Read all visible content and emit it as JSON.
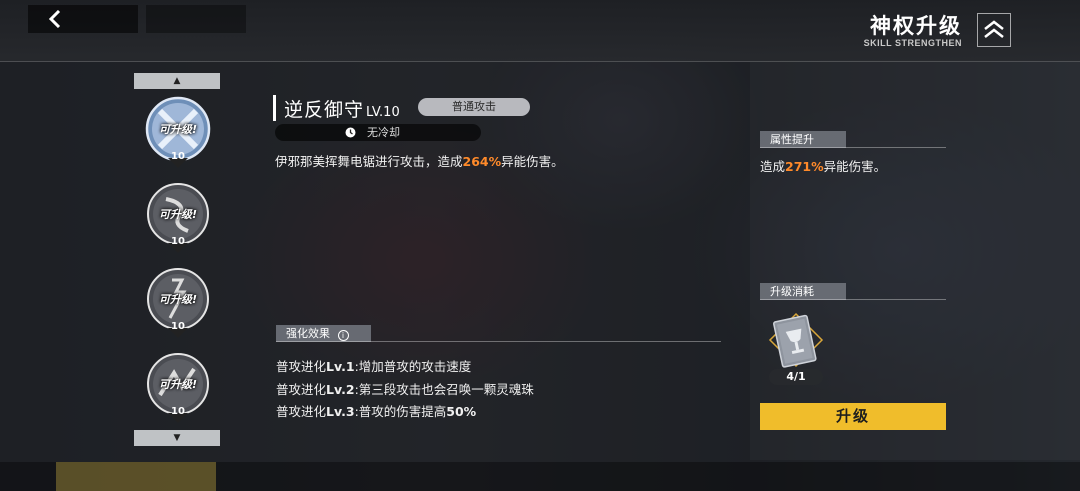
{
  "header": {
    "back_icon": "chevron-left-icon",
    "title": "神权升级",
    "subtitle": "SKILL STRENGTHEN",
    "rank_icon": "double-chevron-up-icon"
  },
  "skill_list": {
    "items": [
      {
        "status": "可升级!",
        "level": "10",
        "selected": true
      },
      {
        "status": "可升级!",
        "level": "10",
        "selected": false
      },
      {
        "status": "可升级!",
        "level": "10",
        "selected": false
      },
      {
        "status": "可升级!",
        "level": "10",
        "selected": false
      }
    ]
  },
  "skill": {
    "name": "逆反御守",
    "level_text": "LV.10",
    "type_tag": "普通攻击",
    "cooldown": "无冷却",
    "desc_pre": "伊邪那美挥舞电锯进行攻击，造成",
    "desc_value": "264%",
    "desc_post": "异能伤害。"
  },
  "enhance": {
    "heading": "强化效果",
    "info_icon": "info-circle-icon",
    "items": [
      {
        "prefix": "普攻进化",
        "lv": "Lv.1",
        "text": ":增加普攻的攻击速度",
        "highlight": ""
      },
      {
        "prefix": "普攻进化",
        "lv": "Lv.2",
        "text": ":第三段攻击也会召唤一颗灵魂珠",
        "highlight": ""
      },
      {
        "prefix": "普攻进化",
        "lv": "Lv.3",
        "text": ":普攻的伤害提高",
        "highlight": "50%"
      }
    ]
  },
  "attribute": {
    "heading": "属性提升",
    "text_pre": "造成",
    "value": "271%",
    "text_post": "异能伤害。"
  },
  "cost": {
    "heading": "升级消耗",
    "item_icon": "skill-book-icon",
    "count": "4/1",
    "button_label": "升级"
  },
  "colors": {
    "accent_yellow": "#f0bd2b",
    "highlight_orange": "#ff8a2a"
  }
}
